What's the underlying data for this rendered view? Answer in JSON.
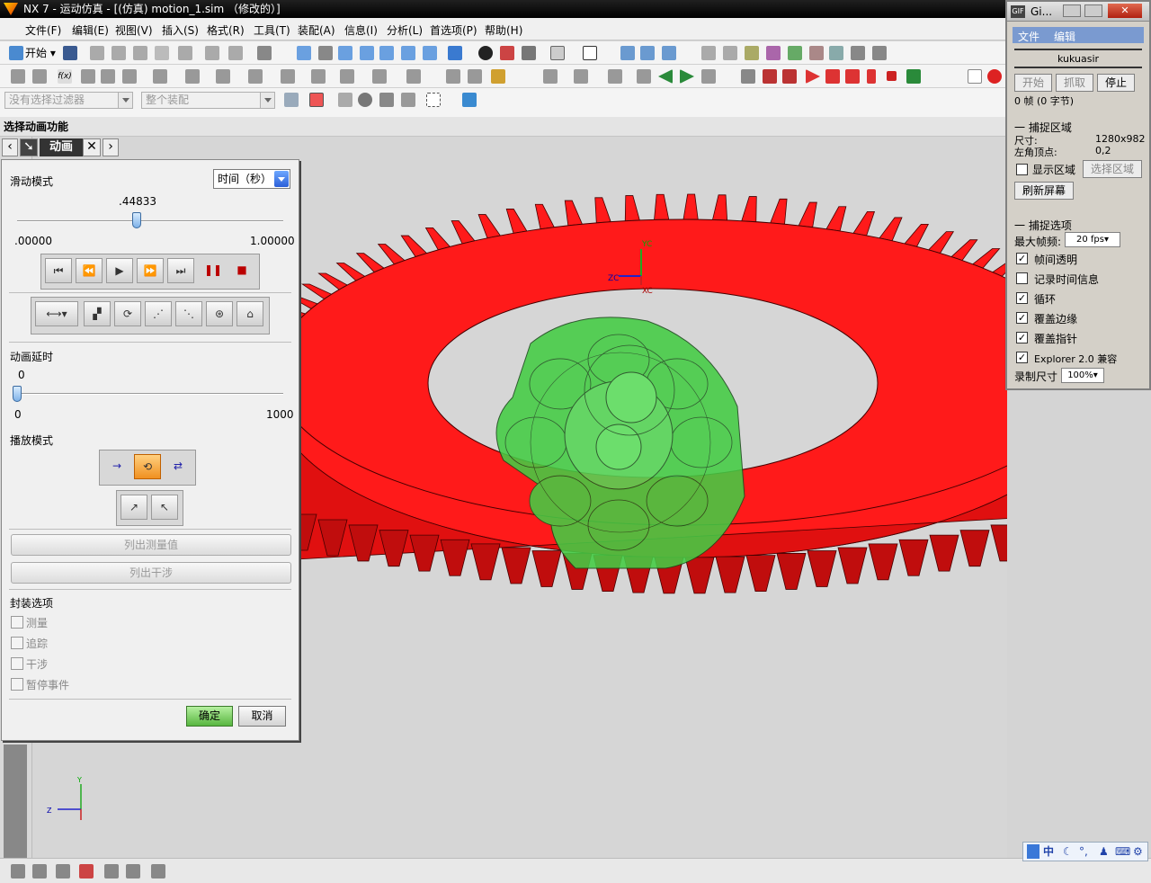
{
  "window": {
    "title": "NX 7 - 运动仿真 - [(仿真) motion_1.sim （修改的）]"
  },
  "menu": [
    "文件(F)",
    "编辑(E)",
    "视图(V)",
    "插入(S)",
    "格式(R)",
    "工具(T)",
    "装配(A)",
    "信息(I)",
    "分析(L)",
    "首选项(P)",
    "帮助(H)"
  ],
  "toolbar": {
    "start_label": "开始",
    "filter_placeholder": "没有选择过滤器",
    "assembly_combo": "整个装配"
  },
  "prompt": "选择动画功能",
  "panel": {
    "tab_label": "动画",
    "slide_mode_label": "滑动模式",
    "slide_mode_value": "时间（秒）",
    "slider_value": ".44833",
    "slider_fraction": 0.44833,
    "slider_min": ".00000",
    "slider_max": "1.00000",
    "delay_label": "动画延时",
    "delay_value": "0",
    "delay_fraction": 0.0,
    "delay_min": "0",
    "delay_max": "1000",
    "play_mode_label": "播放模式",
    "list_measure": "列出测量值",
    "list_interference": "列出干涉",
    "package_label": "封装选项",
    "package_options": [
      "测量",
      "追踪",
      "干涉",
      "暂停事件"
    ],
    "ok": "确定",
    "cancel": "取消"
  },
  "gif": {
    "title": "Gi...",
    "menu": [
      "文件",
      "编辑"
    ],
    "user": "kukuasir",
    "start": "开始",
    "grab": "抓取",
    "stop": "停止",
    "frames": "0 帧 (0 字节)",
    "capture_area": "捕捉区域",
    "size_label": "尺寸:",
    "size_value": "1280x982",
    "corner_label": "左角顶点:",
    "corner_value": "0,2",
    "show_area": "显示区域",
    "select_area": "选择区域",
    "refresh": "刷新屏幕",
    "capture_options": "捕捉选项",
    "max_fps_label": "最大帧频:",
    "max_fps_value": "20 fps",
    "options": [
      {
        "label": "帧间透明",
        "checked": true
      },
      {
        "label": "记录时间信息",
        "checked": false
      },
      {
        "label": "循环",
        "checked": true
      },
      {
        "label": "覆盖边缘",
        "checked": true
      },
      {
        "label": "覆盖指针",
        "checked": true
      },
      {
        "label": "Explorer 2.0 兼容",
        "checked": true
      }
    ],
    "record_size_label": "录制尺寸",
    "record_size_value": "100%"
  },
  "axes": {
    "top_yc": "YC",
    "top_zc": "ZC",
    "top_xc": "XC",
    "bottom_y": "Y",
    "bottom_z": "Z"
  },
  "ime": "中",
  "colors": {
    "ring_gear": "#ff1a1a",
    "pinion": "#44cc44",
    "accent": "#2b5fd8"
  }
}
